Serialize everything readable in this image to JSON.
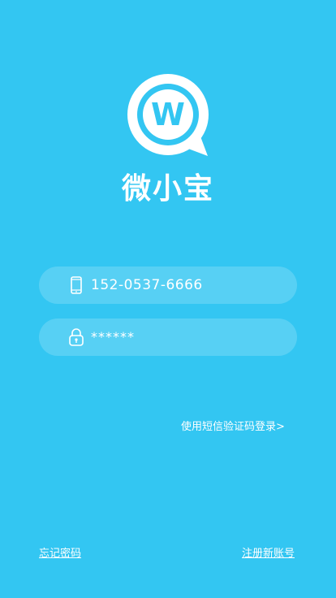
{
  "app": {
    "brand_name": "微小宝",
    "logo_letter": "W",
    "background_color": "#33c6f2"
  },
  "login_form": {
    "phone": {
      "icon": "phone-icon",
      "value": "152-0537-6666"
    },
    "password": {
      "icon": "lock-icon",
      "value": "******"
    }
  },
  "links": {
    "sms_login": "使用短信验证码登录>",
    "forgot_password": "忘记密码",
    "register": "注册新账号"
  }
}
